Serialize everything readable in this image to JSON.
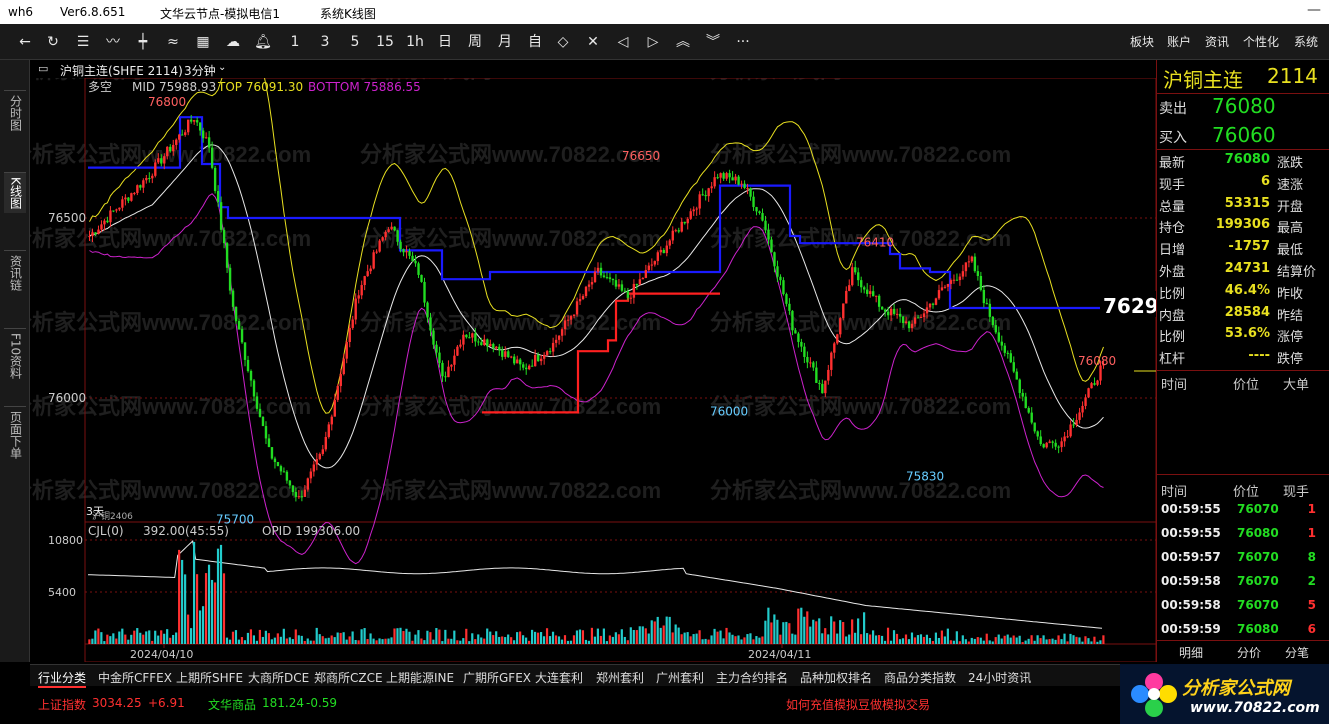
{
  "window": {
    "app": "wh6",
    "version": "Ver6.8.651",
    "server": "文华云节点-模拟电信1",
    "title": "系统K线图"
  },
  "toolbar": {
    "periods": [
      "1",
      "3",
      "5",
      "15",
      "1h",
      "日",
      "周",
      "月",
      "自"
    ],
    "right_menu": [
      "板块",
      "账户",
      "资讯",
      "个性化",
      "系统"
    ]
  },
  "left_tabs": [
    "分时图",
    "K线图",
    "资讯链",
    "F10资料",
    "页面下单"
  ],
  "chart_header": {
    "contract": "沪铜主连(SHFE 2114)",
    "period": "3分钟"
  },
  "indicator_line": {
    "mode": "多空",
    "mid": "MID 75988.93",
    "top": "TOP 76091.30",
    "bottom": "BOTTOM 75886.55"
  },
  "price_axis": [
    "76500",
    "76000"
  ],
  "price_markers": [
    "76800",
    "76650",
    "76410",
    "76080",
    "76000",
    "75830",
    "75700"
  ],
  "current_price_flag": "7629",
  "main_chart_note": "3天",
  "main_chart_note2": "沪铜2406",
  "volume_header": {
    "name": "CJL(0)",
    "value": "392.00(45:55)",
    "opid": "OPID 199306.00"
  },
  "volume_axis": [
    "10800",
    "5400"
  ],
  "date_labels": [
    "2024/04/10",
    "2024/04/11"
  ],
  "quote": {
    "name": "沪铜主连",
    "code": "2114",
    "sell_label": "卖出",
    "sell_price": "76080",
    "buy_label": "买入",
    "buy_price": "76060",
    "rows": [
      {
        "label": "最新",
        "value": "76080",
        "label2": "涨跌",
        "color": "#22dd22"
      },
      {
        "label": "现手",
        "value": "6",
        "label2": "速涨",
        "color": "#e8e020"
      },
      {
        "label": "总量",
        "value": "53315",
        "label2": "开盘",
        "color": "#e8e020"
      },
      {
        "label": "持仓",
        "value": "199306",
        "label2": "最高",
        "color": "#e8e020"
      },
      {
        "label": "日增",
        "value": "-1757",
        "label2": "最低",
        "color": "#e8e020"
      },
      {
        "label": "外盘",
        "value": "24731",
        "label2": "结算价",
        "color": "#e8e020"
      },
      {
        "label": "比例",
        "value": "46.4%",
        "label2": "昨收",
        "color": "#e8e020"
      },
      {
        "label": "内盘",
        "value": "28584",
        "label2": "昨结",
        "color": "#e8e020"
      },
      {
        "label": "比例",
        "value": "53.6%",
        "label2": "涨停",
        "color": "#e8e020"
      },
      {
        "label": "杠杆",
        "value": "----",
        "label2": "跌停",
        "color": "#e8e020"
      }
    ],
    "section1_headers": [
      "时间",
      "价位",
      "大单"
    ],
    "section2_headers": [
      "时间",
      "价位",
      "现手"
    ],
    "ticks": [
      {
        "time": "00:59:55",
        "price": "76070",
        "vol": "1",
        "volColor": "#ff3030"
      },
      {
        "time": "00:59:55",
        "price": "76080",
        "vol": "1",
        "volColor": "#ff3030"
      },
      {
        "time": "00:59:57",
        "price": "76070",
        "vol": "8",
        "volColor": "#22dd22"
      },
      {
        "time": "00:59:58",
        "price": "76070",
        "vol": "2",
        "volColor": "#22dd22"
      },
      {
        "time": "00:59:58",
        "price": "76070",
        "vol": "5",
        "volColor": "#ff3030"
      },
      {
        "time": "00:59:59",
        "price": "76080",
        "vol": "6",
        "volColor": "#ff3030"
      }
    ],
    "bottom_tabs": [
      "明细",
      "分价",
      "分笔"
    ]
  },
  "bottom_tabs": [
    "行业分类",
    "中金所CFFEX",
    "上期所SHFE",
    "大商所DCE",
    "郑商所CZCE",
    "上期能源INE",
    "广期所GFEX",
    "大连套利",
    "郑州套利",
    "广州套利",
    "主力合约排名",
    "品种加权排名",
    "商品分类指数",
    "24小时资讯"
  ],
  "status": {
    "index1_name": "上证指数",
    "index1_value": "3034.25",
    "index1_change": "+6.91",
    "index2_name": "文华商品",
    "index2_value": "181.24",
    "index2_change": "-0.59",
    "notice": "如何充值模拟豆做模拟交易"
  },
  "logo": {
    "text": "分析家公式网",
    "url": "www.70822.com"
  },
  "watermark": "分析家公式网www.70822.com",
  "colors": {
    "up": "#ff3030",
    "down": "#22dd22",
    "top_line": "#e8e020",
    "bottom_line": "#cc22cc",
    "stop_blue": "#1a1aff",
    "stop_red": "#ff2020",
    "volume": "#22cccc"
  }
}
